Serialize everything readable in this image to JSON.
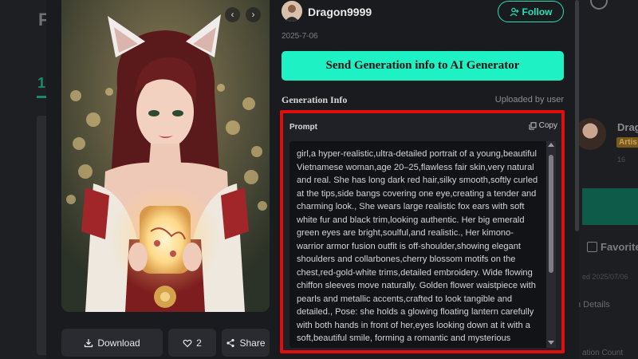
{
  "background": {
    "left_letter": "F",
    "left_tab": "1",
    "right_user_name": "Drag",
    "right_badge": "Artis",
    "right_small_text": "16",
    "right_favorite": "Favorite",
    "right_created": "ed 2025/07/06",
    "right_details": "n Details",
    "right_generation_count": "ation Count"
  },
  "image_card": {
    "prev_icon": "chevron-left-icon",
    "next_icon": "chevron-right-icon",
    "subject": "girl with fox ears holding a glowing lantern"
  },
  "actions": {
    "download_label": "Download",
    "like_count": "2",
    "share_label": "Share"
  },
  "author": {
    "name": "Dragon9999",
    "follow_label": "Follow",
    "date": "2025-7-06"
  },
  "generate_button_label": "Send Generation info to AI Generator",
  "generation_info": {
    "title": "Generation Info",
    "uploaded_by": "Uploaded by user",
    "prompt_label": "Prompt",
    "copy_label": "Copy",
    "prompt_text": "girl,a hyper-realistic,ultra-detailed portrait of a young,beautiful Vietnamese woman,age 20–25,flawless fair skin,very natural and real. She has long dark red hair,silky smooth,softly curled at the tips,side bangs covering one eye,creating a tender and charming look., She wears large realistic fox ears with soft white fur and black trim,looking authentic. Her big emerald green eyes are bright,soulful,and realistic., Her kimono-warrior armor fusion outfit is off-shoulder,showing elegant shoulders and collarbones,cherry blossom motifs on the chest,red-gold-white trims,detailed embroidery. Wide flowing chiffon sleeves move naturally. Golden flower waistpiece with pearls and metallic accents,crafted to look tangible and detailed., Pose: she holds a glowing floating lantern carefully with both hands in front of her,eyes looking down at it with a soft,beautiful smile, forming a romantic and mysterious atmosphere."
  },
  "colors": {
    "accent": "#1ef2c5",
    "highlight_border": "#e00e0e",
    "panel_bg": "#202127"
  }
}
